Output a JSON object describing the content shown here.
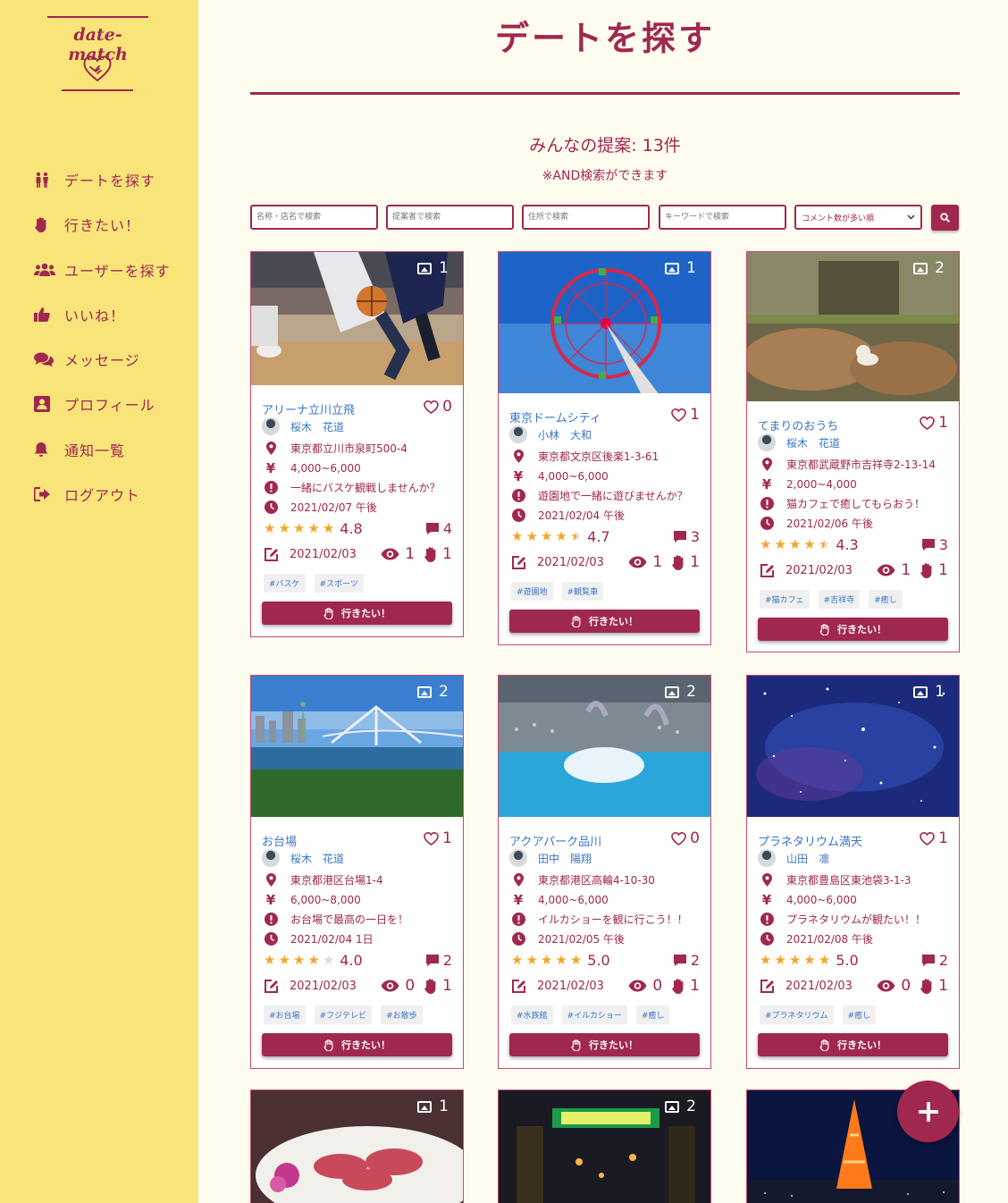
{
  "sidebar": {
    "logo_text": "date-match",
    "items": [
      {
        "label": "デートを探す",
        "icon": "couple-icon"
      },
      {
        "label": "行きたい！",
        "icon": "hand-icon"
      },
      {
        "label": "ユーザーを探す",
        "icon": "users-icon"
      },
      {
        "label": "いいね！",
        "icon": "thumbs-up-icon"
      },
      {
        "label": "メッセージ",
        "icon": "comments-icon"
      },
      {
        "label": "プロフィール",
        "icon": "profile-icon"
      },
      {
        "label": "通知一覧",
        "icon": "bell-icon"
      },
      {
        "label": "ログアウト",
        "icon": "logout-icon"
      }
    ]
  },
  "header": {
    "title": "デートを探す",
    "count_text": "みんなの提案: 13件",
    "note": "※AND検索ができます"
  },
  "search": {
    "name_placeholder": "名称・店名で検索",
    "proposer_placeholder": "提案者で検索",
    "address_placeholder": "住所で検索",
    "keyword_placeholder": "キーワードで検索",
    "sort_selected": "コメント数が多い順"
  },
  "colors": {
    "accent": "#a0284f",
    "sidebar_bg": "#f9e47a",
    "page_bg": "#fffdf0",
    "link": "#3a74c9",
    "star": "#f5a524"
  },
  "cards": [
    {
      "title": "アリーナ立川立飛",
      "likes": "0",
      "images": "1",
      "user": "桜木　花道",
      "address": "東京都立川市泉町500-4",
      "price": "4,000~6,000",
      "message": "一緒にバスケ観戦しませんか？",
      "datetime": "2021/02/07 午後",
      "rating": 4.8,
      "rating_text": "4.8",
      "comments": "4",
      "posted": "2021/02/03",
      "views": "1",
      "wants": "1",
      "tags": [
        "#バスケ",
        "#スポーツ"
      ],
      "button": "行きたい！"
    },
    {
      "title": "東京ドームシティ",
      "likes": "1",
      "images": "1",
      "user": "小林　大和",
      "address": "東京都文京区後楽1-3-61",
      "price": "4,000~6,000",
      "message": "遊園地で一緒に遊びませんか？",
      "datetime": "2021/02/04 午後",
      "rating": 4.7,
      "rating_text": "4.7",
      "comments": "3",
      "posted": "2021/02/03",
      "views": "1",
      "wants": "1",
      "tags": [
        "#遊園地",
        "#観覧車"
      ],
      "button": "行きたい！"
    },
    {
      "title": "てまりのおうち",
      "likes": "1",
      "images": "2",
      "user": "桜木　花道",
      "address": "東京都武蔵野市吉祥寺2-13-14",
      "price": "2,000~4,000",
      "message": "猫カフェで癒してもらおう！",
      "datetime": "2021/02/06 午後",
      "rating": 4.3,
      "rating_text": "4.3",
      "comments": "3",
      "posted": "2021/02/03",
      "views": "1",
      "wants": "1",
      "tags": [
        "#猫カフェ",
        "#吉祥寺",
        "#癒し"
      ],
      "button": "行きたい！"
    },
    {
      "title": "お台場",
      "likes": "1",
      "images": "2",
      "user": "桜木　花道",
      "address": "東京都港区台場1-4",
      "price": "6,000~8,000",
      "message": "お台場で最高の一日を！",
      "datetime": "2021/02/04 1日",
      "rating": 4.0,
      "rating_text": "4.0",
      "comments": "2",
      "posted": "2021/02/03",
      "views": "0",
      "wants": "1",
      "tags": [
        "#お台場",
        "#フジテレビ",
        "#お散歩"
      ],
      "button": "行きたい！"
    },
    {
      "title": "アクアパーク品川",
      "likes": "0",
      "images": "2",
      "user": "田中　陽翔",
      "address": "東京都港区高輪4-10-30",
      "price": "4,000~6,000",
      "message": "イルカショーを観に行こう！！",
      "datetime": "2021/02/05 午後",
      "rating": 5.0,
      "rating_text": "5.0",
      "comments": "2",
      "posted": "2021/02/03",
      "views": "0",
      "wants": "1",
      "tags": [
        "#水族館",
        "#イルカショー",
        "#癒し"
      ],
      "button": "行きたい！"
    },
    {
      "title": "プラネタリウム満天",
      "likes": "1",
      "images": "1",
      "user": "山田　凛",
      "address": "東京都豊島区東池袋3-1-3",
      "price": "4,000~6,000",
      "message": "プラネタリウムが観たい！！",
      "datetime": "2021/02/08 午後",
      "rating": 5.0,
      "rating_text": "5.0",
      "comments": "2",
      "posted": "2021/02/03",
      "views": "0",
      "wants": "1",
      "tags": [
        "#プラネタリウム",
        "#癒し"
      ],
      "button": "行きたい！"
    },
    {
      "images": "1"
    },
    {
      "images": "2"
    },
    {
      "images": ""
    }
  ]
}
